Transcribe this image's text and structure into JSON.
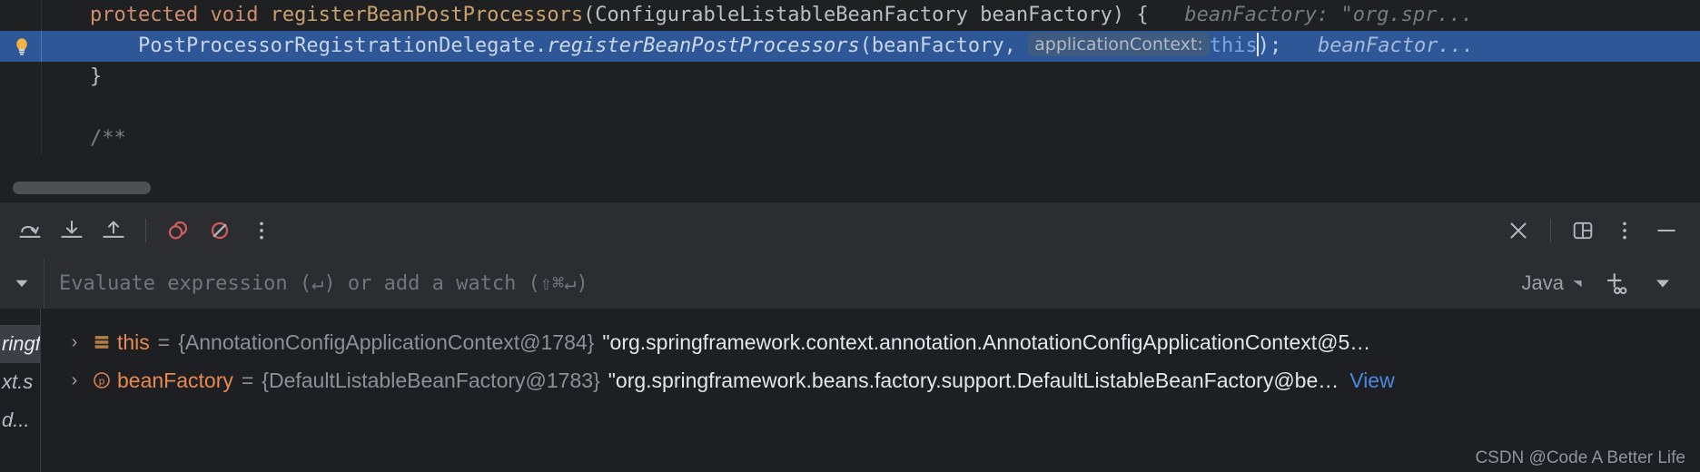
{
  "editor": {
    "lines": [
      {
        "id": "line-signature",
        "highlighted": false,
        "indent": "    ",
        "kw": "protected",
        "kw2": "void",
        "method": "registerBeanPostProcessors",
        "params": "(ConfigurableListableBeanFactory beanFactory) {",
        "inlay_hint": "beanFactory: \"org.spr..."
      },
      {
        "id": "line-call",
        "highlighted": true,
        "indent": "        ",
        "qualifier": "PostProcessorRegistrationDelegate.",
        "call": "registerBeanPostProcessors",
        "arg_open": "(beanFactory,",
        "param_hint": "applicationContext:",
        "this_keyword": "this",
        "arg_close": ");",
        "inlay_hint": "beanFactor..."
      },
      {
        "id": "line-close-brace",
        "highlighted": false,
        "text": "    }"
      },
      {
        "id": "line-blank",
        "highlighted": false,
        "text": ""
      },
      {
        "id": "line-javadoc-start",
        "highlighted": false,
        "text": "    /**",
        "comment": true
      }
    ],
    "gutter_icon": "lightbulb-icon"
  },
  "toolbar": {
    "left_buttons": [
      {
        "name": "step-over-button",
        "icon": "step-over-icon",
        "tooltip": "Step Over"
      },
      {
        "name": "step-into-button",
        "icon": "step-into-icon",
        "tooltip": "Step Into"
      },
      {
        "name": "step-out-button",
        "icon": "step-out-icon",
        "tooltip": "Step Out"
      },
      {
        "name": "view-breakpoints-button",
        "icon": "breakpoints-icon",
        "tooltip": "View Breakpoints"
      },
      {
        "name": "mute-breakpoints-button",
        "icon": "mute-breakpoints-icon",
        "tooltip": "Mute Breakpoints"
      },
      {
        "name": "more-options-button",
        "icon": "more-vertical-icon",
        "tooltip": "More"
      }
    ],
    "right_buttons": [
      {
        "name": "close-button",
        "icon": "close-icon",
        "tooltip": "Close"
      },
      {
        "name": "layout-settings-button",
        "icon": "layout-panel-icon",
        "tooltip": "Layout Settings"
      },
      {
        "name": "options-button",
        "icon": "more-vertical-icon",
        "tooltip": "Options"
      },
      {
        "name": "minimize-button",
        "icon": "minimize-icon",
        "tooltip": "Minimize"
      }
    ]
  },
  "evaluate_bar": {
    "expand_icon": "chevron-down-icon",
    "placeholder": "Evaluate expression (↵) or add a watch (⇧⌘↵)",
    "value": "",
    "language": "Java",
    "language_caret": "▾",
    "add_watch_icon": "add-watch-icon",
    "history_icon": "chevron-down-icon"
  },
  "frames_panel": {
    "rows": [
      {
        "text": "ringf",
        "selected": true
      },
      {
        "text": "xt.s",
        "selected": false
      },
      {
        "text": "d...",
        "selected": false
      }
    ]
  },
  "variables": {
    "rows": [
      {
        "name_id": "variable-row-this",
        "chevron": "›",
        "icon": "stack-frame-icon",
        "name": "this",
        "equals": "=",
        "type": "{AnnotationConfigApplicationContext@1784}",
        "value": "\"org.springframework.context.annotation.AnnotationConfigApplicationContext@5…",
        "link": ""
      },
      {
        "name_id": "variable-row-beanfactory",
        "chevron": "›",
        "icon": "parameter-icon",
        "name": "beanFactory",
        "equals": "=",
        "type": "{DefaultListableBeanFactory@1783}",
        "value": "\"org.springframework.beans.factory.support.DefaultListableBeanFactory@be…",
        "link": "View"
      }
    ]
  },
  "watermark": {
    "text": "CSDN @Code A Better Life"
  },
  "colors": {
    "selection_blue": "#2e5797",
    "accent_orange": "#e8894f",
    "link_blue": "#4a88e0",
    "breakpoint_red": "#db5c5c",
    "editor_bg": "#1f2022",
    "panel_bg": "#2b2d30"
  }
}
